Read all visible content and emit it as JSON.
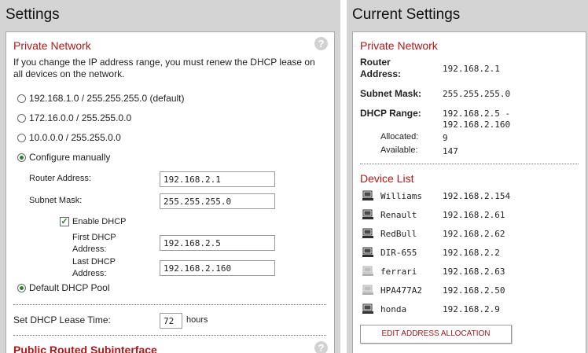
{
  "settings": {
    "title": "Settings",
    "private_network": {
      "heading": "Private Network",
      "help": "?",
      "description_line1": "If you change the IP address range, you must renew the DHCP lease on",
      "description_line2": "all devices on the network.",
      "options": [
        {
          "label": "192.168.1.0 / 255.255.255.0 (default)",
          "selected": false
        },
        {
          "label": "172.16.0.0 / 255.255.0.0",
          "selected": false
        },
        {
          "label": "10.0.0.0 / 255.255.0.0",
          "selected": false
        },
        {
          "label": "Configure manually",
          "selected": true
        }
      ],
      "router_address_label": "Router Address:",
      "router_address_value": "192.168.2.1",
      "subnet_mask_label": "Subnet Mask:",
      "subnet_mask_value": "255.255.255.0",
      "enable_dhcp_label": "Enable DHCP",
      "enable_dhcp_checked": true,
      "first_dhcp_label_line1": "First DHCP",
      "first_dhcp_label_line2": "Address:",
      "first_dhcp_value": "192.168.2.5",
      "last_dhcp_label_line1": "Last DHCP",
      "last_dhcp_label_line2": "Address:",
      "last_dhcp_value": "192.168.2.160",
      "default_pool_label": "Default DHCP Pool",
      "default_pool_selected": true
    },
    "lease": {
      "label": "Set DHCP Lease Time:",
      "value": "72",
      "unit": "hours"
    },
    "public_routed": {
      "heading": "Public Routed Subinterface",
      "help": "?"
    }
  },
  "current": {
    "title": "Current Settings",
    "private_network": {
      "heading": "Private Network",
      "router_label_line1": "Router",
      "router_label_line2": "Address:",
      "router_value": "192.168.2.1",
      "subnet_label": "Subnet Mask:",
      "subnet_value": "255.255.255.0",
      "dhcp_range_label": "DHCP Range:",
      "dhcp_range_line1": "192.168.2.5 -",
      "dhcp_range_line2": "192.168.2.160",
      "allocated_label": "Allocated:",
      "allocated_value": "9",
      "available_label": "Available:",
      "available_value": "147"
    },
    "device_list": {
      "heading": "Device List",
      "devices": [
        {
          "name": "Williams",
          "ip": "192.168.2.154",
          "active": true
        },
        {
          "name": "Renault",
          "ip": "192.168.2.61",
          "active": true
        },
        {
          "name": "RedBull",
          "ip": "192.168.2.62",
          "active": true
        },
        {
          "name": "DIR-655",
          "ip": "192.168.2.2",
          "active": true
        },
        {
          "name": "ferrari",
          "ip": "192.168.2.63",
          "active": false
        },
        {
          "name": "HPA477A2",
          "ip": "192.168.2.50",
          "active": false
        },
        {
          "name": "honda",
          "ip": "192.168.2.9",
          "active": true
        }
      ],
      "edit_button": "EDIT ADDRESS ALLOCATION"
    }
  }
}
